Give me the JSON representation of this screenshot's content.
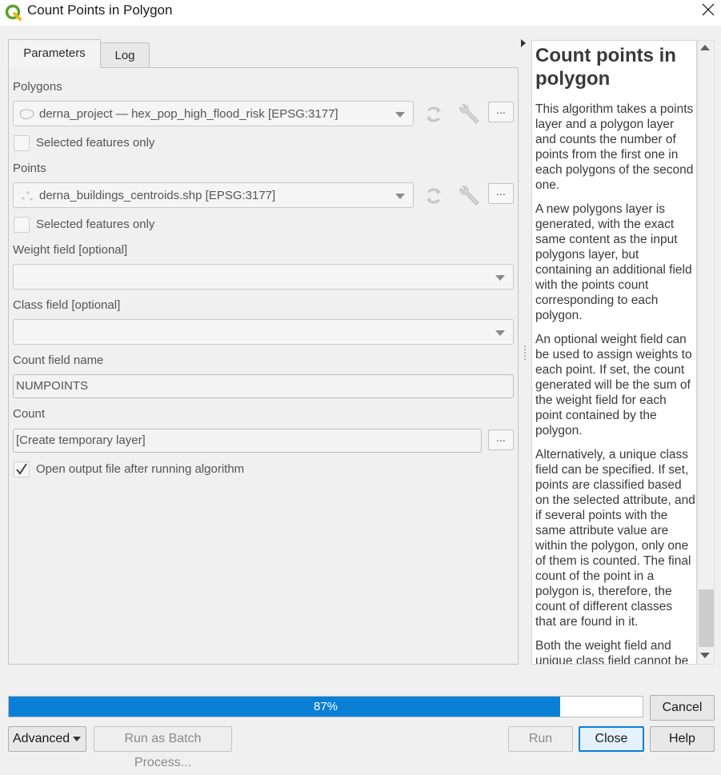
{
  "window": {
    "title": "Count Points in Polygon"
  },
  "tabs": [
    {
      "label": "Parameters",
      "active": true
    },
    {
      "label": "Log",
      "active": false
    }
  ],
  "params": {
    "polygons": {
      "label": "Polygons",
      "value": "derna_project — hex_pop_high_flood_risk [EPSG:3177]",
      "selected_only": "Selected features only"
    },
    "points": {
      "label": "Points",
      "value": "derna_buildings_centroids.shp [EPSG:3177]",
      "selected_only": "Selected features only"
    },
    "weight_field": {
      "label": "Weight field [optional]",
      "value": ""
    },
    "class_field": {
      "label": "Class field [optional]",
      "value": ""
    },
    "count_field": {
      "label": "Count field name",
      "value": "NUMPOINTS"
    },
    "count": {
      "label": "Count",
      "value": "[Create temporary layer]"
    },
    "open_output": {
      "label": "Open output file after running algorithm",
      "checked": true
    },
    "browse_label": "..."
  },
  "help": {
    "title": "Count points in polygon",
    "paragraphs": [
      "This algorithm takes a points layer and a polygon layer and counts the number of points from the first one in each polygons of the second one.",
      "A new polygons layer is generated, with the exact same content as the input polygons layer, but containing an additional field with the points count corresponding to each polygon.",
      "An optional weight field can be used to assign weights to each point. If set, the count generated will be the sum of the weight field for each point contained by the polygon.",
      "Alternatively, a unique class field can be specified. If set, points are classified based on the selected attribute, and if several points with the same attribute value are within the polygon, only one of them is counted. The final count of the point in a polygon is, therefore, the count of different classes that are found in it.",
      "Both the weight field and unique class field cannot be"
    ]
  },
  "progress": {
    "value": 87,
    "label": "87%"
  },
  "buttons": {
    "cancel": "Cancel",
    "advanced": "Advanced",
    "batch": "Run as Batch Process...",
    "run": "Run",
    "close": "Close",
    "help": "Help"
  },
  "colors": {
    "accent": "#0a7fd6",
    "qgis_green": "#5aa02c"
  }
}
